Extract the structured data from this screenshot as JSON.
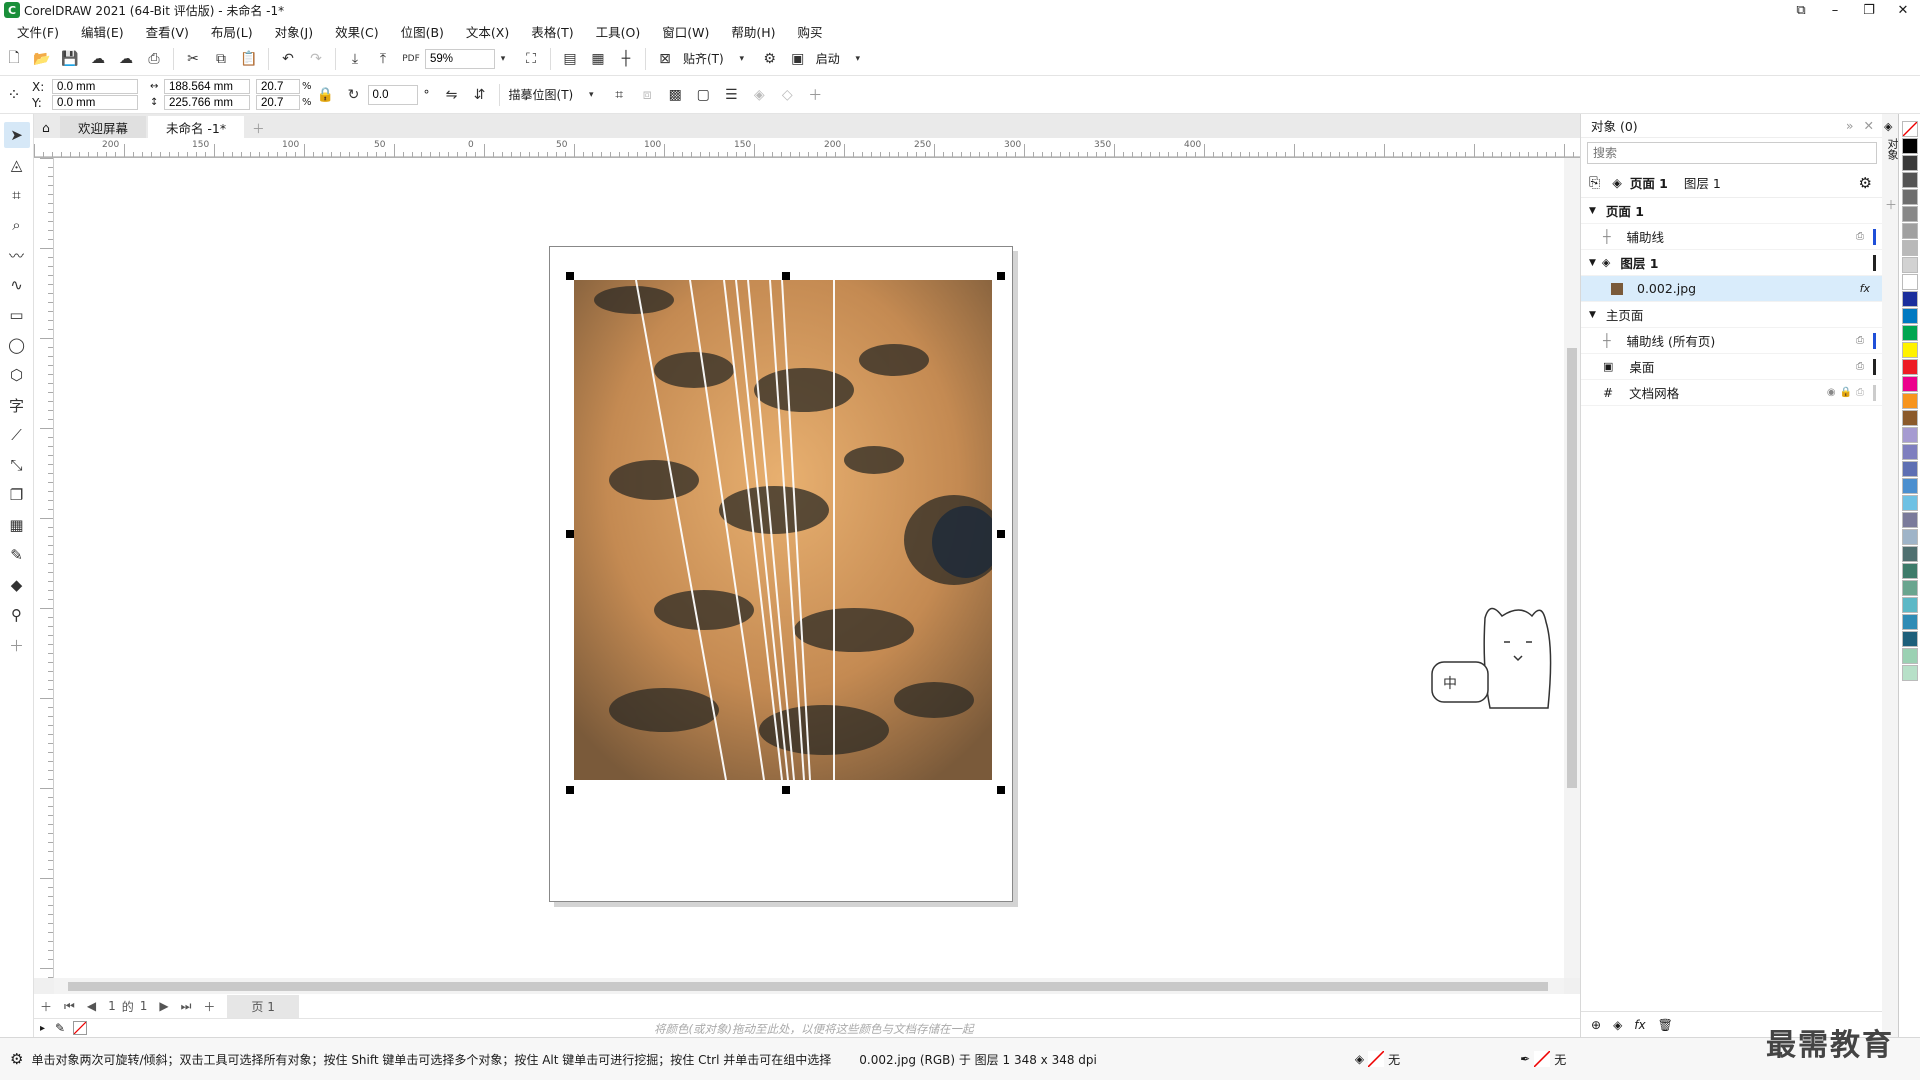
{
  "title": "CorelDRAW 2021 (64-Bit 评估版) - 未命名 -1*",
  "menu": [
    "文件(F)",
    "编辑(E)",
    "查看(V)",
    "布局(L)",
    "对象(J)",
    "效果(C)",
    "位图(B)",
    "文本(X)",
    "表格(T)",
    "工具(O)",
    "窗口(W)",
    "帮助(H)",
    "购买"
  ],
  "toolbar": {
    "zoom": "59%",
    "snap_label": "贴齐(T)",
    "launch_label": "启动"
  },
  "propbar": {
    "x_label": "X:",
    "x_value": "0.0 mm",
    "y_label": "Y:",
    "y_value": "0.0 mm",
    "width": "188.564 mm",
    "height": "225.766 mm",
    "scale_w": "20.7",
    "scale_h": "20.7",
    "percent": "%",
    "rotation": "0.0",
    "degree": "°",
    "trace_label": "描摹位图(T)"
  },
  "tabs": {
    "home_icon": "home-icon",
    "welcome": "欢迎屏幕",
    "document": "未命名 -1*"
  },
  "ruler": {
    "h_ticks": [
      "200",
      "150",
      "100",
      "50",
      "0",
      "50",
      "100",
      "150",
      "200",
      "250",
      "300",
      "350",
      "400"
    ]
  },
  "pagenav": {
    "page_index": "1",
    "of_label": "的",
    "page_total": "1",
    "page_tab": "页 1"
  },
  "colorbar_hint": "将颜色(或对象)拖动至此处，以便将这些颜色与文档存储在一起",
  "status": {
    "hint": "单击对象两次可旋转/倾斜；双击工具可选择所有对象；按住 Shift 键单击可选择多个对象；按住 Alt 键单击可进行挖掘；按住 Ctrl 并单击可在组中选择",
    "object_info": "0.002.jpg (RGB) 于 图层 1 348 x 348 dpi",
    "fill_label": "无",
    "outline_label": "无"
  },
  "docker": {
    "title": "对象 (0)",
    "search_placeholder": "搜索",
    "top_page": "页面 1",
    "top_layer": "图层 1",
    "rows": [
      {
        "label": "页面 1",
        "indent": 0
      },
      {
        "label": "辅助线",
        "indent": 1
      },
      {
        "label": "图层 1",
        "indent": 1
      },
      {
        "label": "0.002.jpg",
        "indent": 2
      },
      {
        "label": "主页面",
        "indent": 0
      },
      {
        "label": "辅助线 (所有页)",
        "indent": 1
      },
      {
        "label": "桌面",
        "indent": 1
      },
      {
        "label": "文档网格",
        "indent": 1
      }
    ],
    "side_tab": "对象"
  },
  "mascot_bubble": "中",
  "watermark": "最需教育",
  "colors": {
    "accent": "#1a8f3a",
    "selection": "#d9ecfb",
    "guide_bar": "#1f4fd8",
    "photo_warm": "#d69a5a",
    "photo_dark": "#2a2a26"
  },
  "palette": [
    "#000000",
    "#3a3a3a",
    "#555555",
    "#6e6e6e",
    "#888888",
    "#a0a0a0",
    "#b9b9b9",
    "#d2d2d2",
    "#ffffff",
    "#1b2e9c",
    "#0079c1",
    "#00a651",
    "#fff200",
    "#ed1c24",
    "#ec008c",
    "#f7941d",
    "#8b5a2b",
    "#a69bd1",
    "#7f7fbf",
    "#5e6fb3",
    "#4b8fcf",
    "#6ec1e4",
    "#7a7a9a",
    "#9fb4c8",
    "#4f6f6f",
    "#3d7b6a",
    "#6aa58f",
    "#5cb8c6",
    "#2e8bb5",
    "#1d5f7a",
    "#9bd1b3",
    "#b7e0c8"
  ]
}
